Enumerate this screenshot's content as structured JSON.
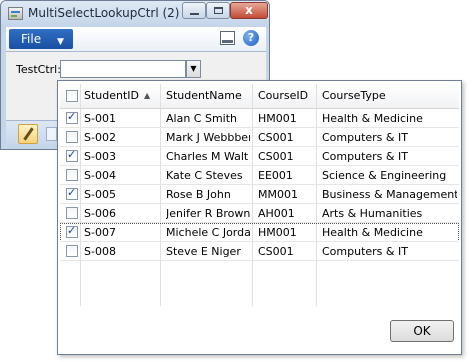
{
  "window": {
    "title": "MultiSelectLookupCtrl (2)",
    "close_glyph": "x",
    "file_menu": "File",
    "file_menu_chevron": "▼",
    "help_glyph": "?",
    "testctrl_label": "TestCtrl:",
    "testctrl_value": "",
    "dropdown_glyph": "▼"
  },
  "lookup": {
    "columns": [
      "StudentID",
      "StudentName",
      "CourseID",
      "CourseType"
    ],
    "sort_indicator": "▲",
    "check_glyph": "✓",
    "rows": [
      {
        "checked": true,
        "id": "S-001",
        "name": "Alan C Smith",
        "course": "HM001",
        "type": "Health & Medicine"
      },
      {
        "checked": false,
        "id": "S-002",
        "name": "Mark J Webbber",
        "course": "CS001",
        "type": "Computers & IT"
      },
      {
        "checked": true,
        "id": "S-003",
        "name": "Charles M Walt",
        "course": "CS001",
        "type": "Computers & IT"
      },
      {
        "checked": false,
        "id": "S-004",
        "name": "Kate C Steves",
        "course": "EE001",
        "type": "Science & Engineering"
      },
      {
        "checked": true,
        "id": "S-005",
        "name": "Rose B John",
        "course": "MM001",
        "type": "Business & Management"
      },
      {
        "checked": false,
        "id": "S-006",
        "name": "Jenifer R Brown",
        "course": "AH001",
        "type": "Arts & Humanities"
      },
      {
        "checked": true,
        "id": "S-007",
        "name": "Michele C Jordan",
        "course": "HM001",
        "type": "Health & Medicine",
        "selected": true
      },
      {
        "checked": false,
        "id": "S-008",
        "name": "Steve E Niger",
        "course": "CS001",
        "type": "Computers & IT"
      }
    ],
    "ok_label": "OK"
  }
}
